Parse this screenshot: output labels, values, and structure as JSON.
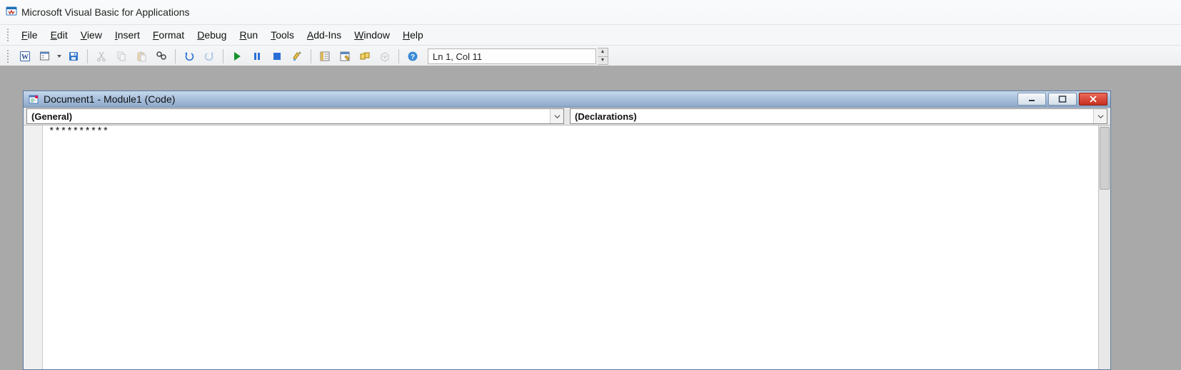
{
  "app": {
    "title": "Microsoft Visual Basic for Applications"
  },
  "menu": [
    {
      "label": "File",
      "ul": "F"
    },
    {
      "label": "Edit",
      "ul": "E"
    },
    {
      "label": "View",
      "ul": "V"
    },
    {
      "label": "Insert",
      "ul": "I"
    },
    {
      "label": "Format",
      "ul": "F",
      "ul_index": 0,
      "rest": "ormat"
    },
    {
      "label": "Debug",
      "ul": "D"
    },
    {
      "label": "Run",
      "ul": "R"
    },
    {
      "label": "Tools",
      "ul": "T"
    },
    {
      "label": "Add-Ins",
      "ul": "A"
    },
    {
      "label": "Window",
      "ul": "W"
    },
    {
      "label": "Help",
      "ul": "H"
    }
  ],
  "toolbar": {
    "lncol": "Ln 1, Col 11"
  },
  "codewin": {
    "title": "Document1 - Module1 (Code)",
    "object_combo": "(General)",
    "proc_combo": "(Declarations)",
    "code": "**********"
  }
}
